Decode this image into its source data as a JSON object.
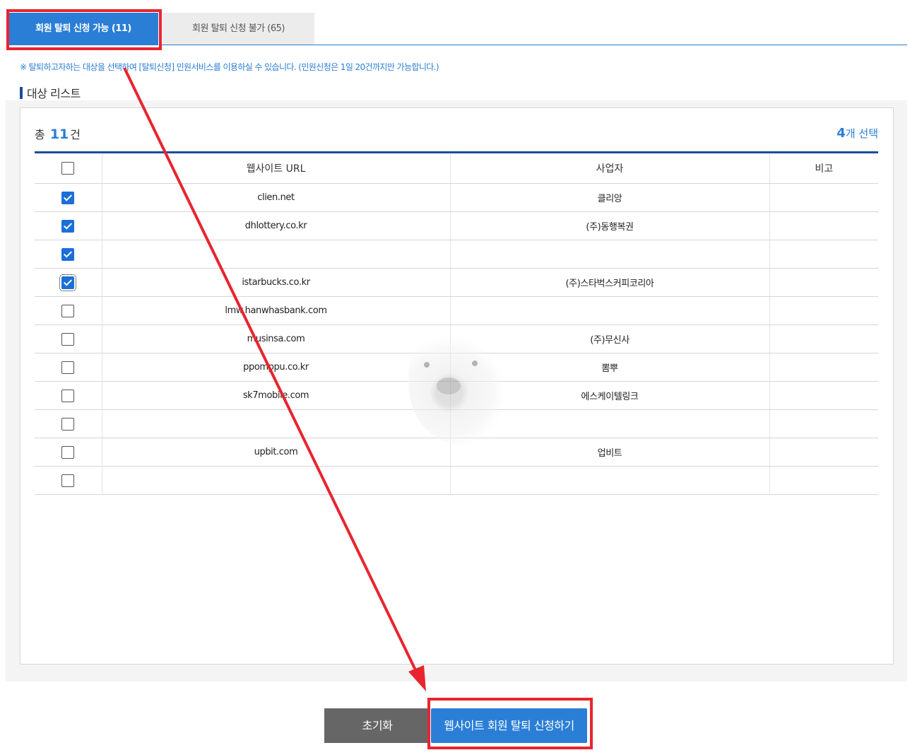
{
  "tabs": {
    "available": "회원 탈퇴 신청 가능 (11)",
    "unavailable": "회원 탈퇴 신청 불가 (65)"
  },
  "notice": "※ 탈퇴하고자하는 대상을 선택하여 [탈퇴신청] 민원서비스를 이용하실 수 있습니다. (민원신청은 1일 20건까지만 가능합니다.)",
  "section_title": "대상 리스트",
  "summary": {
    "total_prefix": "총",
    "total_count": "11",
    "total_suffix": "건",
    "selected_count": "4",
    "selected_suffix": "개 선택"
  },
  "table": {
    "headers": [
      "웹사이트 URL",
      "사업자",
      "비고"
    ],
    "rows": [
      {
        "checked": true,
        "url": "clien.net",
        "company": "클리앙",
        "note": ""
      },
      {
        "checked": true,
        "url": "dhlottery.co.kr",
        "company": "(주)동행복권",
        "note": ""
      },
      {
        "checked": true,
        "url": "",
        "company": "",
        "note": ""
      },
      {
        "checked": true,
        "url": "istarbucks.co.kr",
        "company": "(주)스타벅스커피코리아",
        "note": ""
      },
      {
        "checked": false,
        "url": "lmw.hanwhasbank.com",
        "company": "",
        "note": ""
      },
      {
        "checked": false,
        "url": "musinsa.com",
        "company": "(주)무신사",
        "note": ""
      },
      {
        "checked": false,
        "url": "ppomppu.co.kr",
        "company": "뽐뿌",
        "note": ""
      },
      {
        "checked": false,
        "url": "sk7mobile.com",
        "company": "에스케이텔링크",
        "note": ""
      },
      {
        "checked": false,
        "url": "",
        "company": "",
        "note": ""
      },
      {
        "checked": false,
        "url": "upbit.com",
        "company": "업비트",
        "note": ""
      },
      {
        "checked": false,
        "url": "",
        "company": "",
        "note": ""
      }
    ]
  },
  "buttons": {
    "reset": "초기화",
    "submit": "웹사이트 회원 탈퇴 신청하기"
  },
  "colors": {
    "accent": "#2a7ed6",
    "annotation": "#e8252f"
  }
}
